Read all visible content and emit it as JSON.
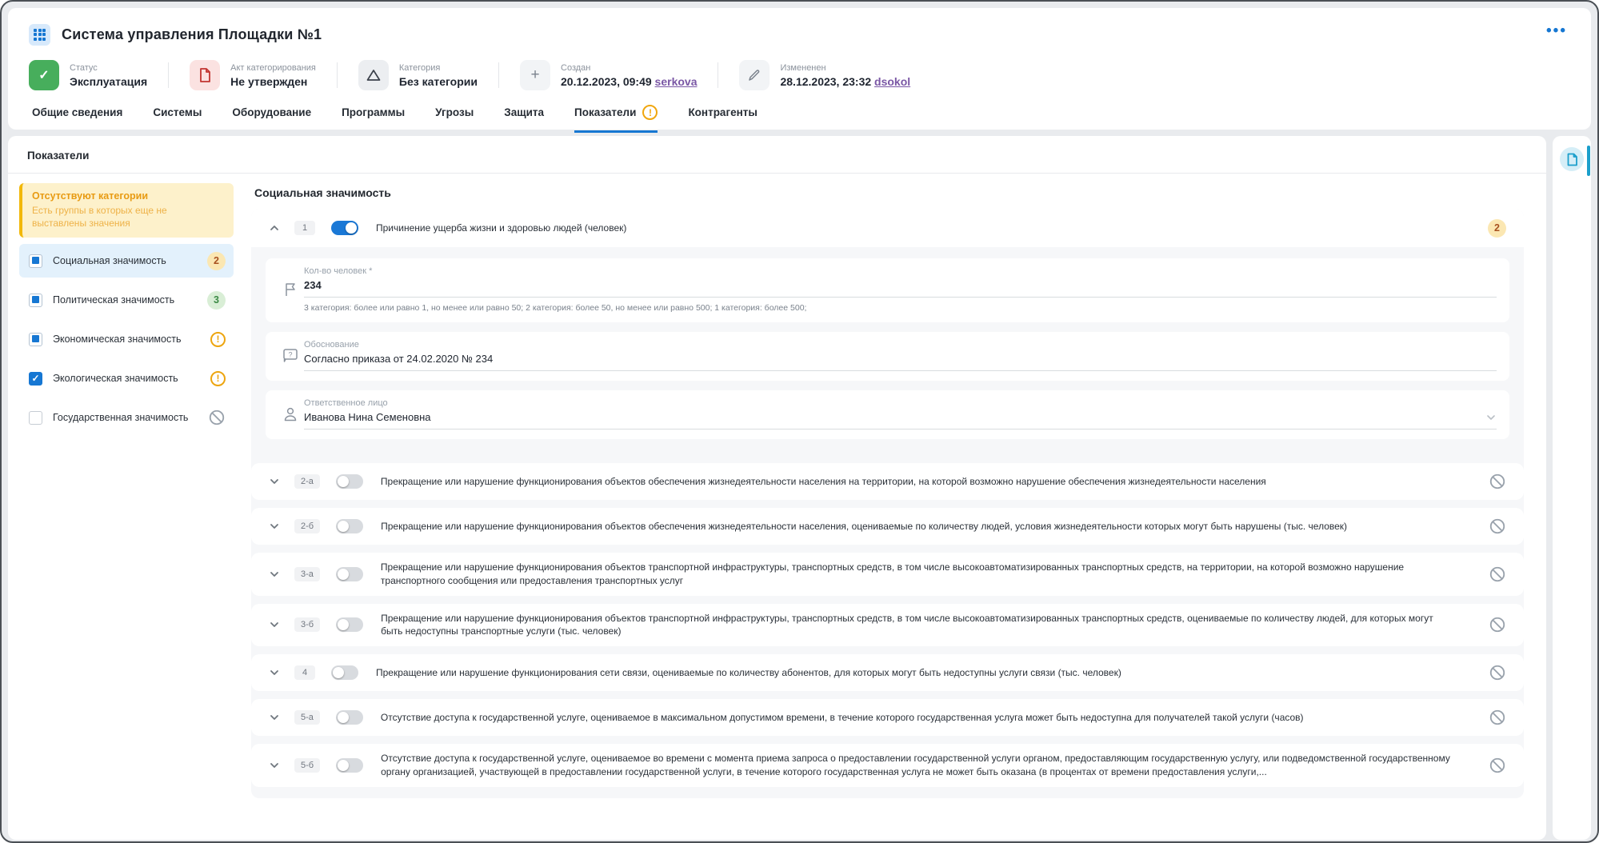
{
  "window": {
    "title": "Система управления Площадки №1",
    "menu_dots": "•••"
  },
  "meta": {
    "status": {
      "label": "Статус",
      "value": "Эксплуатация"
    },
    "act": {
      "label": "Акт категорирования",
      "value": "Не утвержден"
    },
    "category": {
      "label": "Категория",
      "value": "Без категории"
    },
    "created": {
      "label": "Создан",
      "value": "20.12.2023, 09:49 ",
      "user": "serkova"
    },
    "modified": {
      "label": "Измененен",
      "value": "28.12.2023, 23:32 ",
      "user": "dsokol"
    }
  },
  "tabs": [
    {
      "label": "Общие сведения"
    },
    {
      "label": "Системы"
    },
    {
      "label": "Оборудование"
    },
    {
      "label": "Программы"
    },
    {
      "label": "Угрозы"
    },
    {
      "label": "Защита"
    },
    {
      "label": "Показатели",
      "warning": "!",
      "active": true
    },
    {
      "label": "Контрагенты"
    }
  ],
  "panel": {
    "title": "Показатели"
  },
  "sidebar": {
    "warning": {
      "title": "Отсутствуют категории",
      "text": "Есть группы в которых еще не выставлены значения"
    },
    "items": [
      {
        "label": "Социальная значимость",
        "badge": "2",
        "state": "selected"
      },
      {
        "label": "Политическая значимость",
        "badge": "3"
      },
      {
        "label": "Экономическая значимость",
        "badge": "!"
      },
      {
        "label": "Экологическая значимость",
        "badge": "!"
      },
      {
        "label": "Государственная значимость",
        "badge": "blocked"
      }
    ],
    "checkmark": "✓",
    "warn_mark": "!"
  },
  "content": {
    "title": "Социальная значимость",
    "expanded": {
      "num": "1",
      "text": "Причинение ущерба жизни и здоровью людей (человек)",
      "badge": "2",
      "fields": [
        {
          "label": "Кол-во человек *",
          "value": "234",
          "hint": "3 категория: более или равно 1, но менее или равно 50; 2 категория: более 50, но менее или равно 500; 1 категория: более 500;"
        },
        {
          "label": "Обоснование",
          "value": "Согласно приказа от 24.02.2020 № 234"
        },
        {
          "label": "Ответственное лицо",
          "value": "Иванова Нина Семеновна"
        }
      ]
    },
    "rows": [
      {
        "num": "2-а",
        "text": "Прекращение или нарушение функционирования объектов обеспечения жизнедеятельности населения на территории, на которой возможно нарушение обеспечения жизнедеятельности населения"
      },
      {
        "num": "2-б",
        "text": "Прекращение или нарушение функционирования объектов обеспечения жизнедеятельности населения, оцениваемые по количеству людей, условия жизнедеятельности которых могут быть нарушены (тыс. человек)"
      },
      {
        "num": "3-а",
        "text": "Прекращение или нарушение функционирования объектов транспортной инфраструктуры, транспортных средств, в том числе высокоавтоматизированных транспортных средств, на территории, на которой возможно нарушение транспортного сообщения или предоставления транспортных услуг"
      },
      {
        "num": "3-б",
        "text": "Прекращение или нарушение функционирования объектов транспортной инфраструктуры, транспортных средств, в том числе высокоавтоматизированных транспортных средств, оцениваемые по количеству людей, для которых могут быть недоступны транспортные услуги (тыс. человек)"
      },
      {
        "num": "4",
        "text": "Прекращение или нарушение функционирования сети связи, оцениваемые по количеству абонентов, для которых могут быть недоступны услуги связи (тыс. человек)"
      },
      {
        "num": "5-а",
        "text": "Отсутствие доступа к государственной услуге, оцениваемое в максимальном допустимом времени, в течение которого государственная услуга может быть недоступна для получателей такой услуги (часов)"
      },
      {
        "num": "5-б",
        "text": "Отсутствие доступа к государственной услуге, оцениваемое во времени с момента приема запроса о предоставлении государственной услуги органом, предоставляющим государственную услугу, или подведомственной государственному органу организацией, участвующей в предоставлении государственной услуги, в течение которого государственная услуга не может быть оказана (в процентах от времени предоставления услуги,..."
      }
    ]
  },
  "colors": {
    "accent_blue": "#1677d2",
    "status_green": "#47ae5c",
    "act_red": "#c23530",
    "warn_orange": "#eda50f",
    "badge_yellow_bg": "#fbe7b2",
    "badge_yellow_text": "#a8511f",
    "badge_green_bg": "#d9eed6",
    "badge_green_text": "#3c8a45",
    "rail_teal": "#1b9fcb",
    "link_purple": "#7a57a5"
  }
}
